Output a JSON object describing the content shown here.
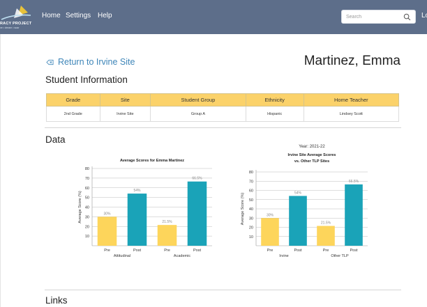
{
  "nav": {
    "logo_title": "RACY PROJECT",
    "logo_subtitle": "ve • dream • soar",
    "links": [
      "Home",
      "Settings",
      "Help"
    ],
    "search_placeholder": "Search",
    "cut_off_text": "Lo"
  },
  "header": {
    "back_link": "Return to Irvine Site",
    "student_name": "Martinez, Emma"
  },
  "student_info": {
    "title": "Student Information",
    "columns": [
      "Grade",
      "Site",
      "Student Group",
      "Ethnicity",
      "Home Teacher"
    ],
    "row": [
      "2nd Grade",
      "Irvine Site",
      "Group A",
      "Hispanic",
      "Lindsey Scott"
    ]
  },
  "data_section": {
    "title": "Data"
  },
  "links_section": {
    "title": "Links"
  },
  "colors": {
    "pre": "#fdd55b",
    "post": "#1aa3b8",
    "nav": "#5d6e8a",
    "accent": "#3d85b8"
  },
  "chart_data": [
    {
      "type": "bar",
      "title": "Average Scores for Emma Martinez",
      "ylabel": "Average Score (%)",
      "ylim": [
        0,
        80
      ],
      "yticks": [
        10,
        20,
        30,
        40,
        50,
        60,
        70,
        80
      ],
      "groups": [
        "Attitudinal",
        "Academic"
      ],
      "categories": [
        "Pre",
        "Post",
        "Pre",
        "Post"
      ],
      "values": [
        30,
        54,
        21.5,
        66.5
      ],
      "labels": [
        "30%",
        "54%",
        "21.5%",
        "66.5%"
      ]
    },
    {
      "type": "bar",
      "year": "Year: 2021-22",
      "title": "Irvine Site Average Scores",
      "subtitle": "vs. Other TLP Sites",
      "ylabel": "Average Score (%)",
      "ylim": [
        0,
        80
      ],
      "yticks": [
        10,
        20,
        30,
        40,
        50,
        60,
        70,
        80
      ],
      "groups": [
        "Irvine",
        "Other TLP"
      ],
      "categories": [
        "Pre",
        "Post",
        "Pre",
        "Post"
      ],
      "values": [
        30,
        54,
        21.5,
        66.5
      ],
      "labels": [
        "30%",
        "54%",
        "21.5%",
        "66.5%"
      ]
    }
  ]
}
